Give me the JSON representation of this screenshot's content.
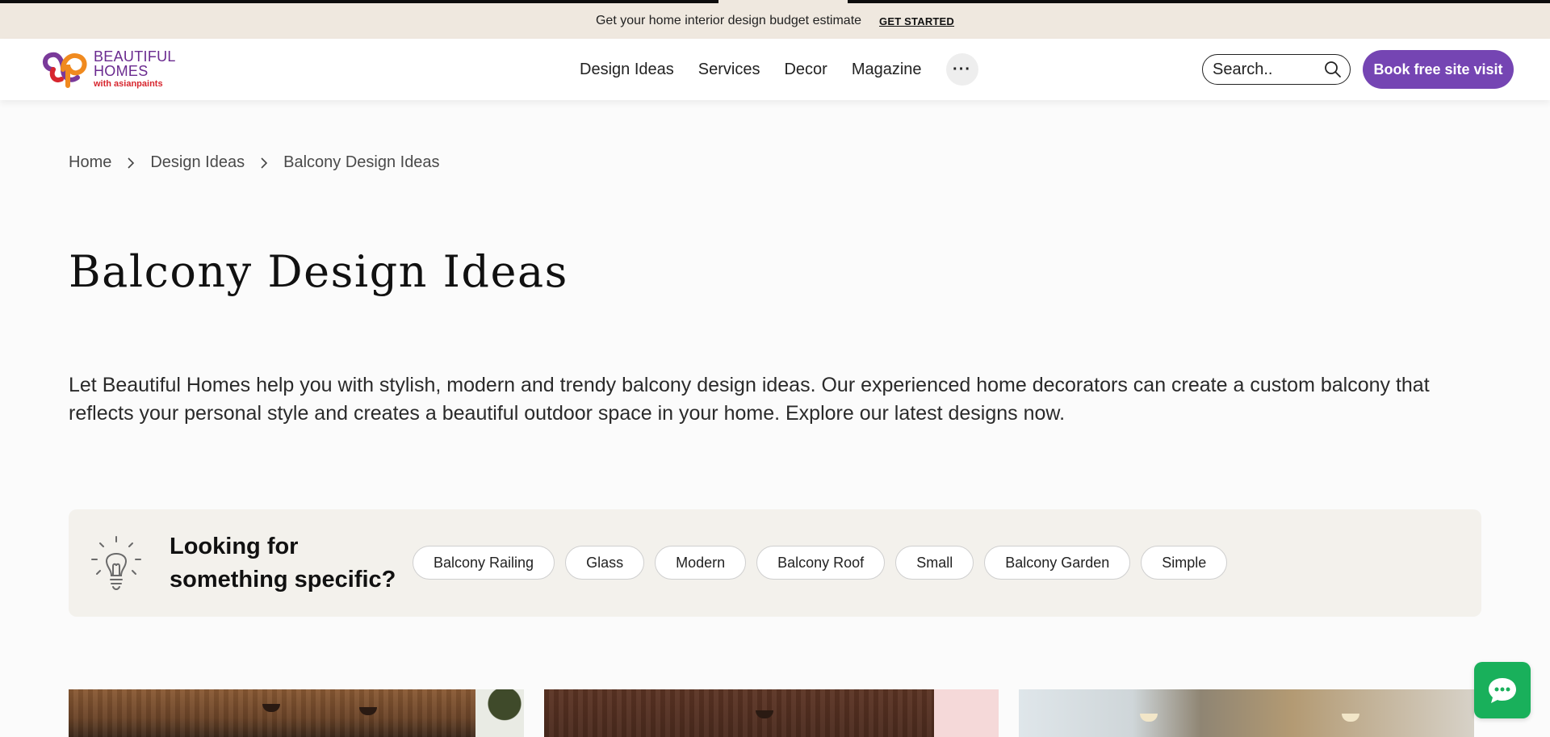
{
  "announcement": {
    "message": "Get your home interior design budget estimate",
    "cta": "GET STARTED"
  },
  "header": {
    "logo": {
      "line1": "BEAUTIFUL",
      "line2": "HOMES",
      "line3": "with asianpaints"
    },
    "nav": [
      "Design Ideas",
      "Services",
      "Decor",
      "Magazine"
    ],
    "more_icon": "ellipsis-icon",
    "search": {
      "placeholder": "Search..",
      "icon": "search-icon"
    },
    "book_button": "Book free site visit"
  },
  "breadcrumb": [
    "Home",
    "Design Ideas",
    "Balcony Design Ideas"
  ],
  "page_title": "Balcony Design Ideas",
  "intro": "Let Beautiful Homes help you with stylish, modern and trendy balcony design ideas. Our experienced home decorators can create a custom balcony that reflects your personal style and creates a beautiful outdoor space in your home. Explore our latest designs now.",
  "looking_for": {
    "heading": "Looking for something specific?",
    "icon": "lightbulb-icon",
    "chips": [
      "Balcony Railing",
      "Glass",
      "Modern",
      "Balcony Roof",
      "Small",
      "Balcony Garden",
      "Simple"
    ]
  },
  "chat": {
    "icon": "chat-icon",
    "color": "#19b05b"
  },
  "colors": {
    "accent": "#7545b3",
    "topbar": "#efe8df",
    "logo_purple": "#6a2a8f",
    "logo_red": "#d7262e"
  }
}
